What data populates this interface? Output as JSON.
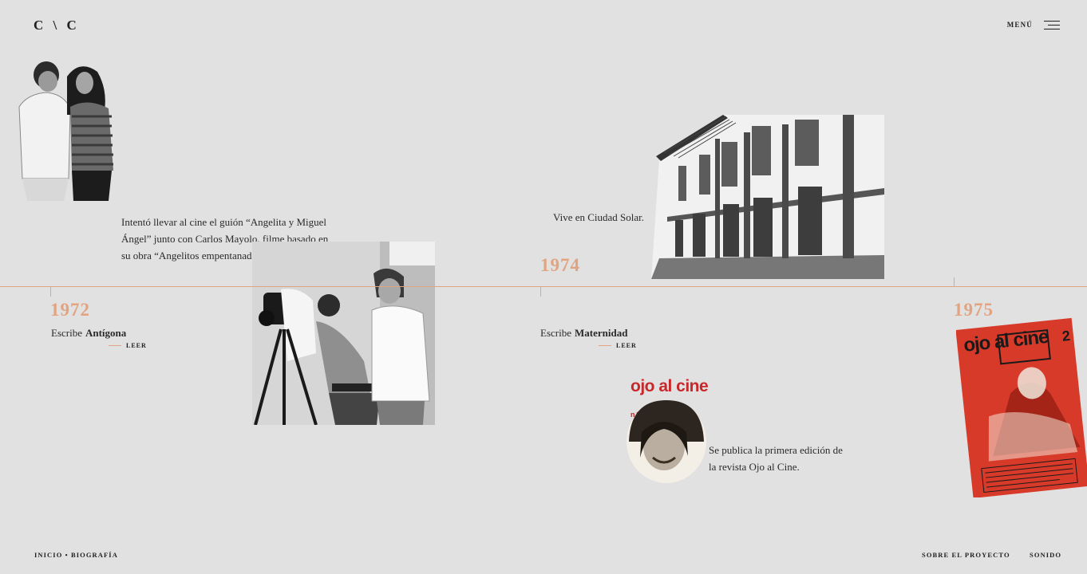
{
  "header": {
    "logo": "C \\ C",
    "menu_label": "MENÚ"
  },
  "events": [
    {
      "year": "1972",
      "text": "Intentó llevar al cine el guión “Angelita y Miguel Ángel” junto con Carlos Mayolo, filme basado en su obra “Angelitos empentanados”.",
      "escribe_prefix": "Escribe",
      "escribe_title": "Antígona",
      "leer": "LEER"
    },
    {
      "year": "1974",
      "text": "Vive en Ciudad Solar.",
      "escribe_prefix": "Escribe",
      "escribe_title": "Maternidad",
      "leer": "LEER",
      "magazine_title": "ojo al cine",
      "magazine_issue": "n.1",
      "caption": "Se publica la primera edición de la revista Ojo al Cine."
    },
    {
      "year": "1975",
      "magazine_title": "ojo al cine",
      "magazine_issue": "2"
    }
  ],
  "footer": {
    "breadcrumb": "INICIO • BIOGRAFÍA",
    "about": "SOBRE EL PROYECTO",
    "sound": "SONIDO"
  },
  "colors": {
    "background": "#e1e1e1",
    "accent": "#e2a380",
    "magazine_red": "#d83a2a"
  },
  "icons": {
    "menu": "hamburger-icon"
  }
}
